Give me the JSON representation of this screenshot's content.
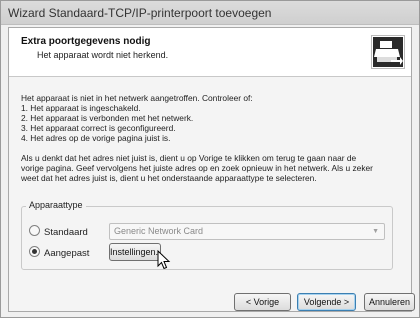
{
  "window": {
    "title": "Wizard Standaard-TCP/IP-printerpoort toevoegen"
  },
  "header": {
    "title": "Extra poortgegevens nodig",
    "subtitle": "Het apparaat wordt niet herkend.",
    "icon": "printer-network-icon"
  },
  "body": {
    "intro": "Het apparaat is niet in het netwerk aangetroffen. Controleer of:",
    "checks": [
      "1. Het apparaat is ingeschakeld.",
      "2. Het apparaat is verbonden met het netwerk.",
      "3. Het apparaat correct is geconfigureerd.",
      "4. Het adres op de vorige pagina juist is."
    ],
    "advice": [
      "Als u denkt dat het adres niet juist is, dient u op Vorige te klikken om terug te gaan naar de",
      "vorige pagina. Geef vervolgens het juiste adres op en zoek opnieuw in het netwerk. Als u zeker",
      "weet dat het adres juist is, dient u het onderstaande apparaattype te selecteren."
    ]
  },
  "device_type": {
    "legend": "Apparaattype",
    "standard_label": "Standaard",
    "standard_selected": false,
    "standard_value": "Generic Network Card",
    "custom_label": "Aangepast",
    "custom_selected": true,
    "settings_button": "Instellingen..."
  },
  "footer": {
    "back": "< Vorige",
    "next": "Volgende >",
    "cancel": "Annuleren"
  }
}
